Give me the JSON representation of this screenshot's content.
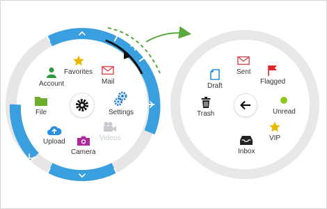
{
  "left_menu": {
    "items": [
      {
        "label": "Favorites",
        "icon": "star-icon",
        "color": "#e8b800"
      },
      {
        "label": "Mail",
        "icon": "mail-icon",
        "color": "#e0474c"
      },
      {
        "label": "Account",
        "icon": "user-icon",
        "color": "#2e9a44"
      },
      {
        "label": "File",
        "icon": "folder-icon",
        "color": "#6cae2b"
      },
      {
        "label": "Settings",
        "icon": "gears-icon",
        "color": "#2a7fd4"
      },
      {
        "label": "Upload",
        "icon": "cloud-upload-icon",
        "color": "#2a8fde"
      },
      {
        "label": "Camera",
        "icon": "camera-icon",
        "color": "#b0279c"
      },
      {
        "label": "Videos",
        "icon": "video-icon",
        "color": "#c9c9cf",
        "disabled": true
      }
    ],
    "center_icon": "gear-icon"
  },
  "right_menu": {
    "items": [
      {
        "label": "Sent",
        "icon": "envelope-icon",
        "color": "#e0474c"
      },
      {
        "label": "Draft",
        "icon": "document-icon",
        "color": "#2a8fde"
      },
      {
        "label": "Flagged",
        "icon": "flag-icon",
        "color": "#e0262a"
      },
      {
        "label": "Trash",
        "icon": "trash-icon",
        "color": "#222222"
      },
      {
        "label": "Unread",
        "icon": "dot-icon",
        "color": "#8bc81e"
      },
      {
        "label": "VIP",
        "icon": "star-icon",
        "color": "#e8b800"
      },
      {
        "label": "Inbox",
        "icon": "inbox-icon",
        "color": "#222222"
      }
    ],
    "center_icon": "back-arrow-icon"
  },
  "colors": {
    "accent": "#3a9fde",
    "ring": "#e6e6e6",
    "arrow": "#5aa83e"
  }
}
